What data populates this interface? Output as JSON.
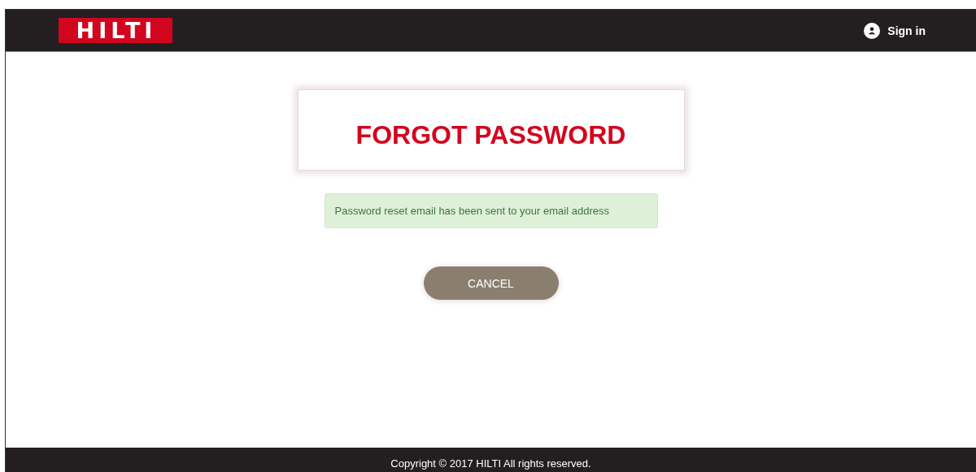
{
  "header": {
    "logo": "HILTI",
    "sign_in": "Sign in"
  },
  "card": {
    "title": "FORGOT PASSWORD"
  },
  "alert": {
    "message": "Password reset email has been sent to your email address"
  },
  "buttons": [
    "CANCEL"
  ],
  "footer": {
    "copyright": "Copyright © 2017 HILTI All rights reserved."
  }
}
